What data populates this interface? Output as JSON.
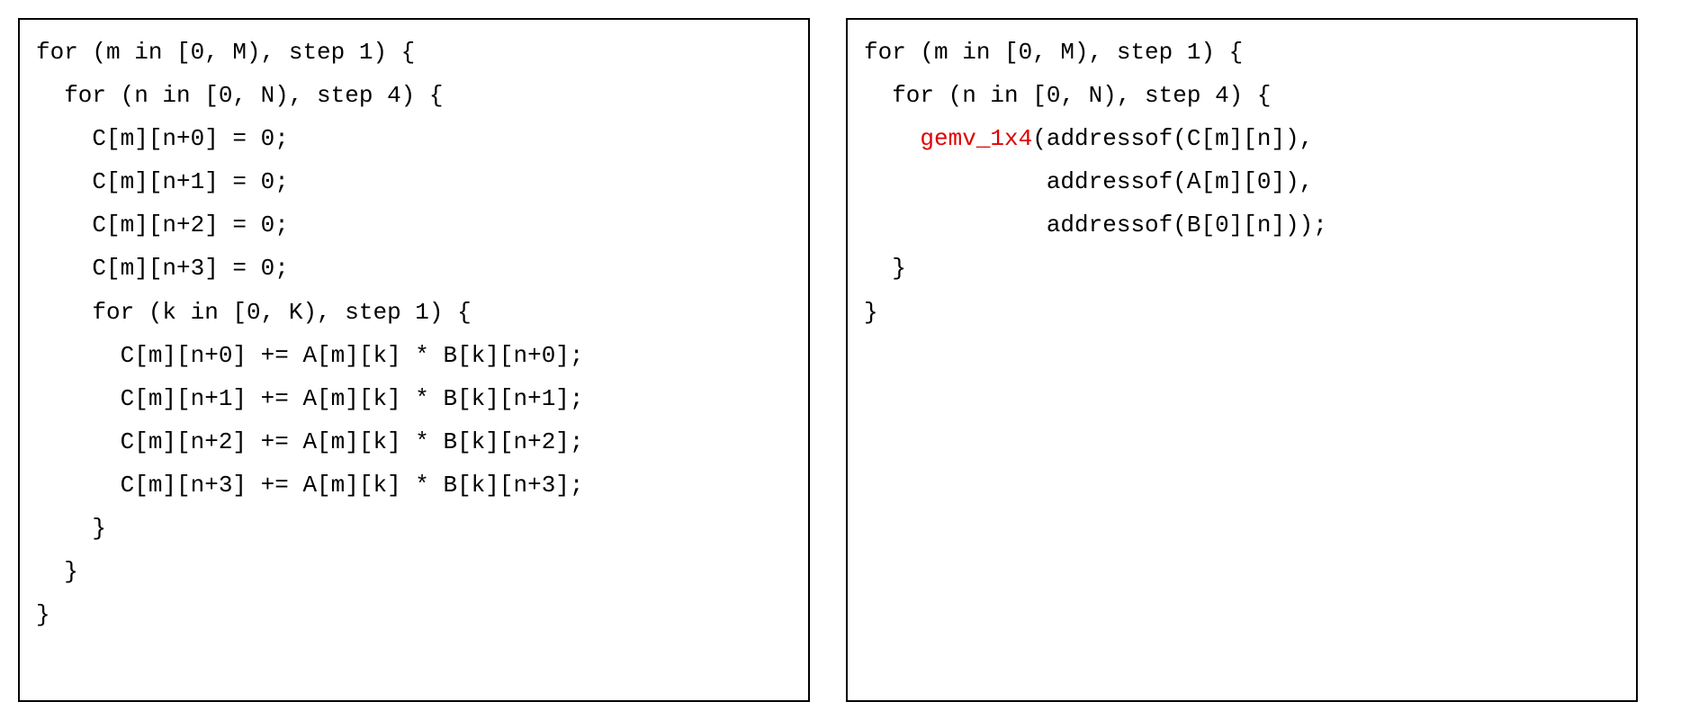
{
  "left": {
    "lines": [
      "for (m in [0, M), step 1) {",
      "  for (n in [0, N), step 4) {",
      "    C[m][n+0] = 0;",
      "    C[m][n+1] = 0;",
      "    C[m][n+2] = 0;",
      "    C[m][n+3] = 0;",
      "    for (k in [0, K), step 1) {",
      "      C[m][n+0] += A[m][k] * B[k][n+0];",
      "      C[m][n+1] += A[m][k] * B[k][n+1];",
      "      C[m][n+2] += A[m][k] * B[k][n+2];",
      "      C[m][n+3] += A[m][k] * B[k][n+3];",
      "    }",
      "  }",
      "}"
    ]
  },
  "right": {
    "lines": [
      "for (m in [0, M), step 1) {",
      "  for (n in [0, N), step 4) {",
      "",
      "",
      "",
      "  }",
      "}"
    ],
    "call_indent": "    ",
    "call_fn": "gemv_1x4",
    "call_arg1": "(addressof(C[m][n]),",
    "call_arg2": "             addressof(A[m][0]),",
    "call_arg3": "             addressof(B[0][n]));"
  }
}
